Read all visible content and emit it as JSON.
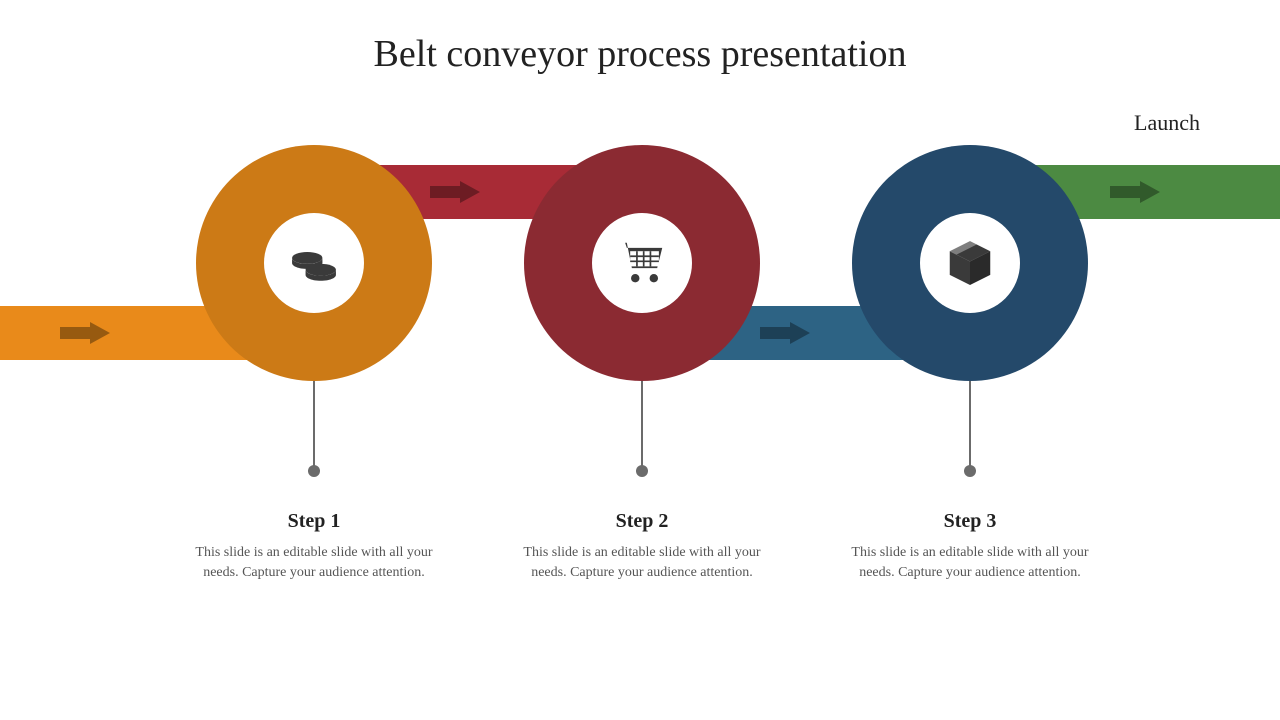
{
  "title": "Belt conveyor process presentation",
  "launch_label": "Launch",
  "steps": [
    {
      "label": "Step 1",
      "desc": "This slide is an editable slide with all your needs. Capture your audience attention.",
      "icon": "coins-icon",
      "circle_color": "#cc7a16",
      "bar_color": "#e98a1a"
    },
    {
      "label": "Step 2",
      "desc": "This slide is an editable slide with all your needs. Capture your audience attention.",
      "icon": "cart-icon",
      "circle_color": "#8b2a32",
      "bar_color": "#a82b36"
    },
    {
      "label": "Step 3",
      "desc": "This slide is an editable slide with all your needs. Capture your audience attention.",
      "icon": "box-icon",
      "circle_color": "#24496a",
      "bar_color": "#2d6384"
    }
  ],
  "final_bar_color": "#4c8a42"
}
